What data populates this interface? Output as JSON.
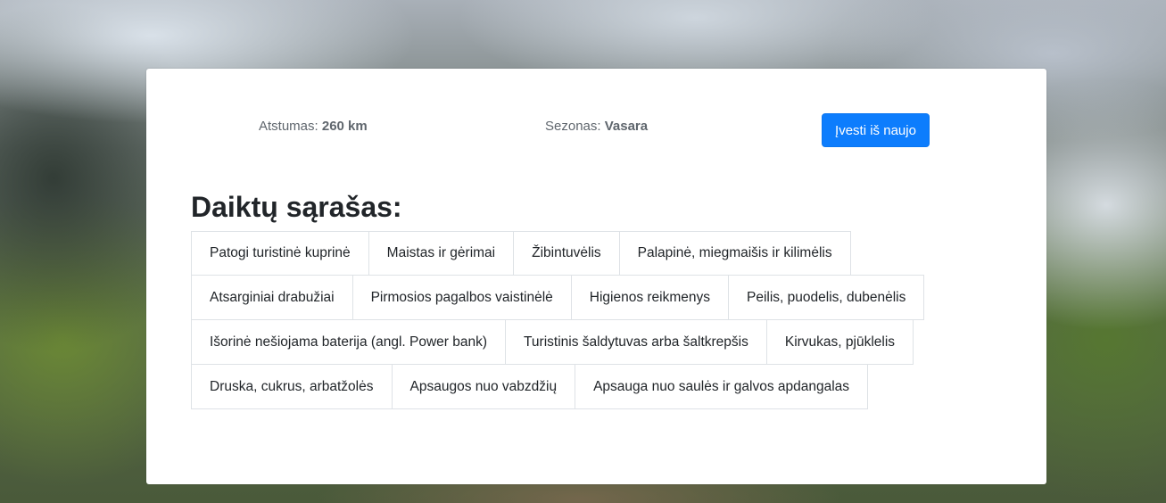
{
  "summary": {
    "distance_label": "Atstumas:",
    "distance_value": "260 km",
    "season_label": "Sezonas:",
    "season_value": "Vasara"
  },
  "reset_button_label": "Įvesti iš naujo",
  "list_title": "Daiktų sąrašas:",
  "items": [
    [
      "Patogi turistinė kuprinė",
      "Maistas ir gėrimai",
      "Žibintuvėlis",
      "Palapinė, miegmaišis ir kilimėlis"
    ],
    [
      "Atsarginiai drabužiai",
      "Pirmosios pagalbos vaistinėlė",
      "Higienos reikmenys",
      "Peilis, puodelis, dubenėlis"
    ],
    [
      "Išorinė nešiojama baterija (angl. Power bank)",
      "Turistinis šaldytuvas arba šaltkrepšis",
      "Kirvukas, pjūklelis"
    ],
    [
      "Druska, cukrus, arbatžolės",
      "Apsaugos nuo vabzdžių",
      "Apsauga nuo saulės ir galvos apdangalas"
    ]
  ]
}
